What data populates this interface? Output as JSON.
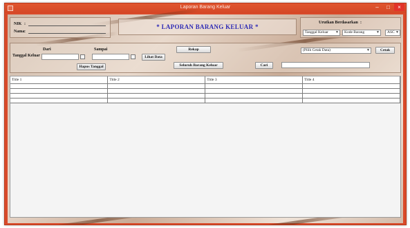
{
  "window": {
    "title": "Laporan Barang Keluar",
    "controls": {
      "minimize": "–",
      "maximize": "□",
      "close": "×"
    }
  },
  "user_info": {
    "nik_label": "NIK",
    "nama_label": "Nama",
    "separator": ":"
  },
  "header": {
    "title": "* LAPORAN BARANG KELUAR *"
  },
  "sort": {
    "label": "Urutkan Berdasarkan",
    "separator": ":",
    "field1": "Tanggal Keluar",
    "field2": "Kode Barang",
    "order": "ASC"
  },
  "filter": {
    "tanggal_label": "Tanggal Keluar",
    "dari_label": "Dari",
    "sampai_label": "Sampai",
    "dari_value": "",
    "sampai_value": "",
    "hapus_tanggal_label": "Hapus Tanggal",
    "lihat_data_label": "Lihat Data",
    "rekap_label": "Rekap",
    "seluruh_label": "Seluruh Barang Keluar",
    "cari_label": "Cari",
    "cari_value": "",
    "cetak_select": "(Pilih Cetak Data)",
    "cetak_label": "Cetak"
  },
  "table": {
    "columns": [
      "Title 1",
      "Title 2",
      "Title 3",
      "Title 4"
    ],
    "rows": [
      [
        "",
        "",
        "",
        ""
      ],
      [
        "",
        "",
        "",
        ""
      ],
      [
        "",
        "",
        "",
        ""
      ],
      [
        "",
        "",
        "",
        ""
      ]
    ]
  },
  "colors": {
    "frame": "#d94a2a",
    "title_text": "#2f2bb5"
  }
}
